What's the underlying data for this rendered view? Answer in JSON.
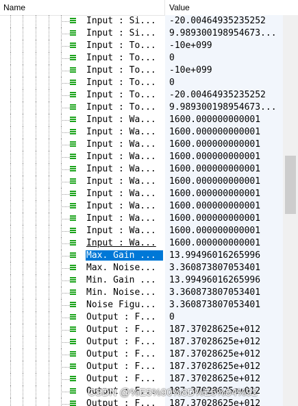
{
  "header": {
    "name_label": "Name",
    "value_label": "Value"
  },
  "rows": [
    {
      "name": "Input : Si...",
      "value": "-20.00464935235252"
    },
    {
      "name": "Input : Si...",
      "value": "9.989300198954673..."
    },
    {
      "name": "Input : To...",
      "value": "-10e+099"
    },
    {
      "name": "Input : To...",
      "value": "0"
    },
    {
      "name": "Input : To...",
      "value": "-10e+099"
    },
    {
      "name": "Input : To...",
      "value": "0"
    },
    {
      "name": "Input : To...",
      "value": "-20.00464935235252"
    },
    {
      "name": "Input : To...",
      "value": "9.989300198954673..."
    },
    {
      "name": "Input : Wa...",
      "value": "1600.000000000001"
    },
    {
      "name": "Input : Wa...",
      "value": "1600.000000000001"
    },
    {
      "name": "Input : Wa...",
      "value": "1600.000000000001"
    },
    {
      "name": "Input : Wa...",
      "value": "1600.000000000001"
    },
    {
      "name": "Input : Wa...",
      "value": "1600.000000000001"
    },
    {
      "name": "Input : Wa...",
      "value": "1600.000000000001"
    },
    {
      "name": "Input : Wa...",
      "value": "1600.000000000001"
    },
    {
      "name": "Input : Wa...",
      "value": "1600.000000000001"
    },
    {
      "name": "Input : Wa...",
      "value": "1600.000000000001"
    },
    {
      "name": "Input : Wa...",
      "value": "1600.000000000001"
    },
    {
      "name": "Input : Wa...",
      "value": "1600.000000000001",
      "underlined": true
    },
    {
      "name": "Max. Gain ...",
      "value": "13.99496016265996",
      "selected": true
    },
    {
      "name": "Max. Noise...",
      "value": "3.360873807053401"
    },
    {
      "name": "Min. Gain ...",
      "value": "13.99496016265996"
    },
    {
      "name": "Min. Noise...",
      "value": "3.360873807053401"
    },
    {
      "name": "Noise Figu...",
      "value": "3.360873807053401"
    },
    {
      "name": "Output : F...",
      "value": "0"
    },
    {
      "name": "Output : F...",
      "value": "187.37028625e+012"
    },
    {
      "name": "Output : F...",
      "value": "187.37028625e+012"
    },
    {
      "name": "Output : F...",
      "value": "187.37028625e+012"
    },
    {
      "name": "Output : F...",
      "value": "187.37028625e+012"
    },
    {
      "name": "Output : F...",
      "value": "187.37028625e+012"
    },
    {
      "name": "Output : F...",
      "value": "187.37028625e+012"
    },
    {
      "name": "Output : F...",
      "value": "187.37028625e+012"
    }
  ],
  "watermark": "CSDN @%E5%90%8D%E5%84%92",
  "colors": {
    "selection": "#0078d7",
    "leaf_icon": "#1aa31a",
    "value_bg": "#f2f6fc"
  }
}
